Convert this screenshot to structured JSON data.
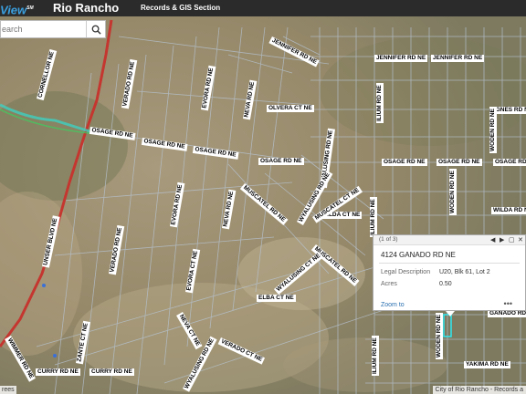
{
  "header": {
    "logo": "View",
    "logo_mark": "SM",
    "city": "Rio Rancho",
    "section": "Records & GIS Section"
  },
  "search": {
    "placeholder": "earch",
    "value": ""
  },
  "popup": {
    "pager": "(1 of 3)",
    "title": "4124 GANADO RD NE",
    "rows": [
      {
        "label": "Legal Description",
        "value": "U20, Blk 61, Lot 2"
      },
      {
        "label": "Acres",
        "value": "0.50"
      }
    ],
    "zoom_label": "Zoom to",
    "more": "•••"
  },
  "attribution": {
    "left": "rees",
    "right": "City of Rio Rancho - Records a"
  },
  "streets": [
    "JENNIFER RD NE",
    "JENNIFER RD NE",
    "JENNIFER RD NE",
    "AGNES RD NE",
    "OLVERA CT NE",
    "OSAGE RD NE",
    "OSAGE RD NE",
    "OSAGE RD NE",
    "OSAGE RD NE",
    "OSAGE RD NE",
    "OSAGE RD NE",
    "OSAGE RD NE",
    "WILDA CT NE",
    "WILDA RD NE",
    "MUSCATEL RD NE",
    "MUSCATEL RD NE",
    "ELBA CT NE",
    "GANADO RD NE",
    "VERADO CT NE",
    "CURRY RD NE",
    "CURRY RD NE",
    "YAKIMA RD NE",
    "UNSER BLVD NE",
    "CORNELLOR NE",
    "VERADO RD NE",
    "VERADO RD NE",
    "EVORA RD NE",
    "EVORA RD NE",
    "EVORA CT NE",
    "NEVA RD NE",
    "NEVA RD NE",
    "NEVA CT NE",
    "WYALUSING RD NE",
    "WYALUSING RD NE",
    "WYALUSING CT NE",
    "WYALUSING RD NE",
    "ILIUM RD NE",
    "ILIUM RD NE",
    "ILIUM RD NE",
    "WODEN RD NE",
    "WODEN RD NE",
    "WODEN RD NE",
    "MUSCATEL CT NE",
    "ZANTE CT NE",
    "WIMMER RD NE"
  ]
}
